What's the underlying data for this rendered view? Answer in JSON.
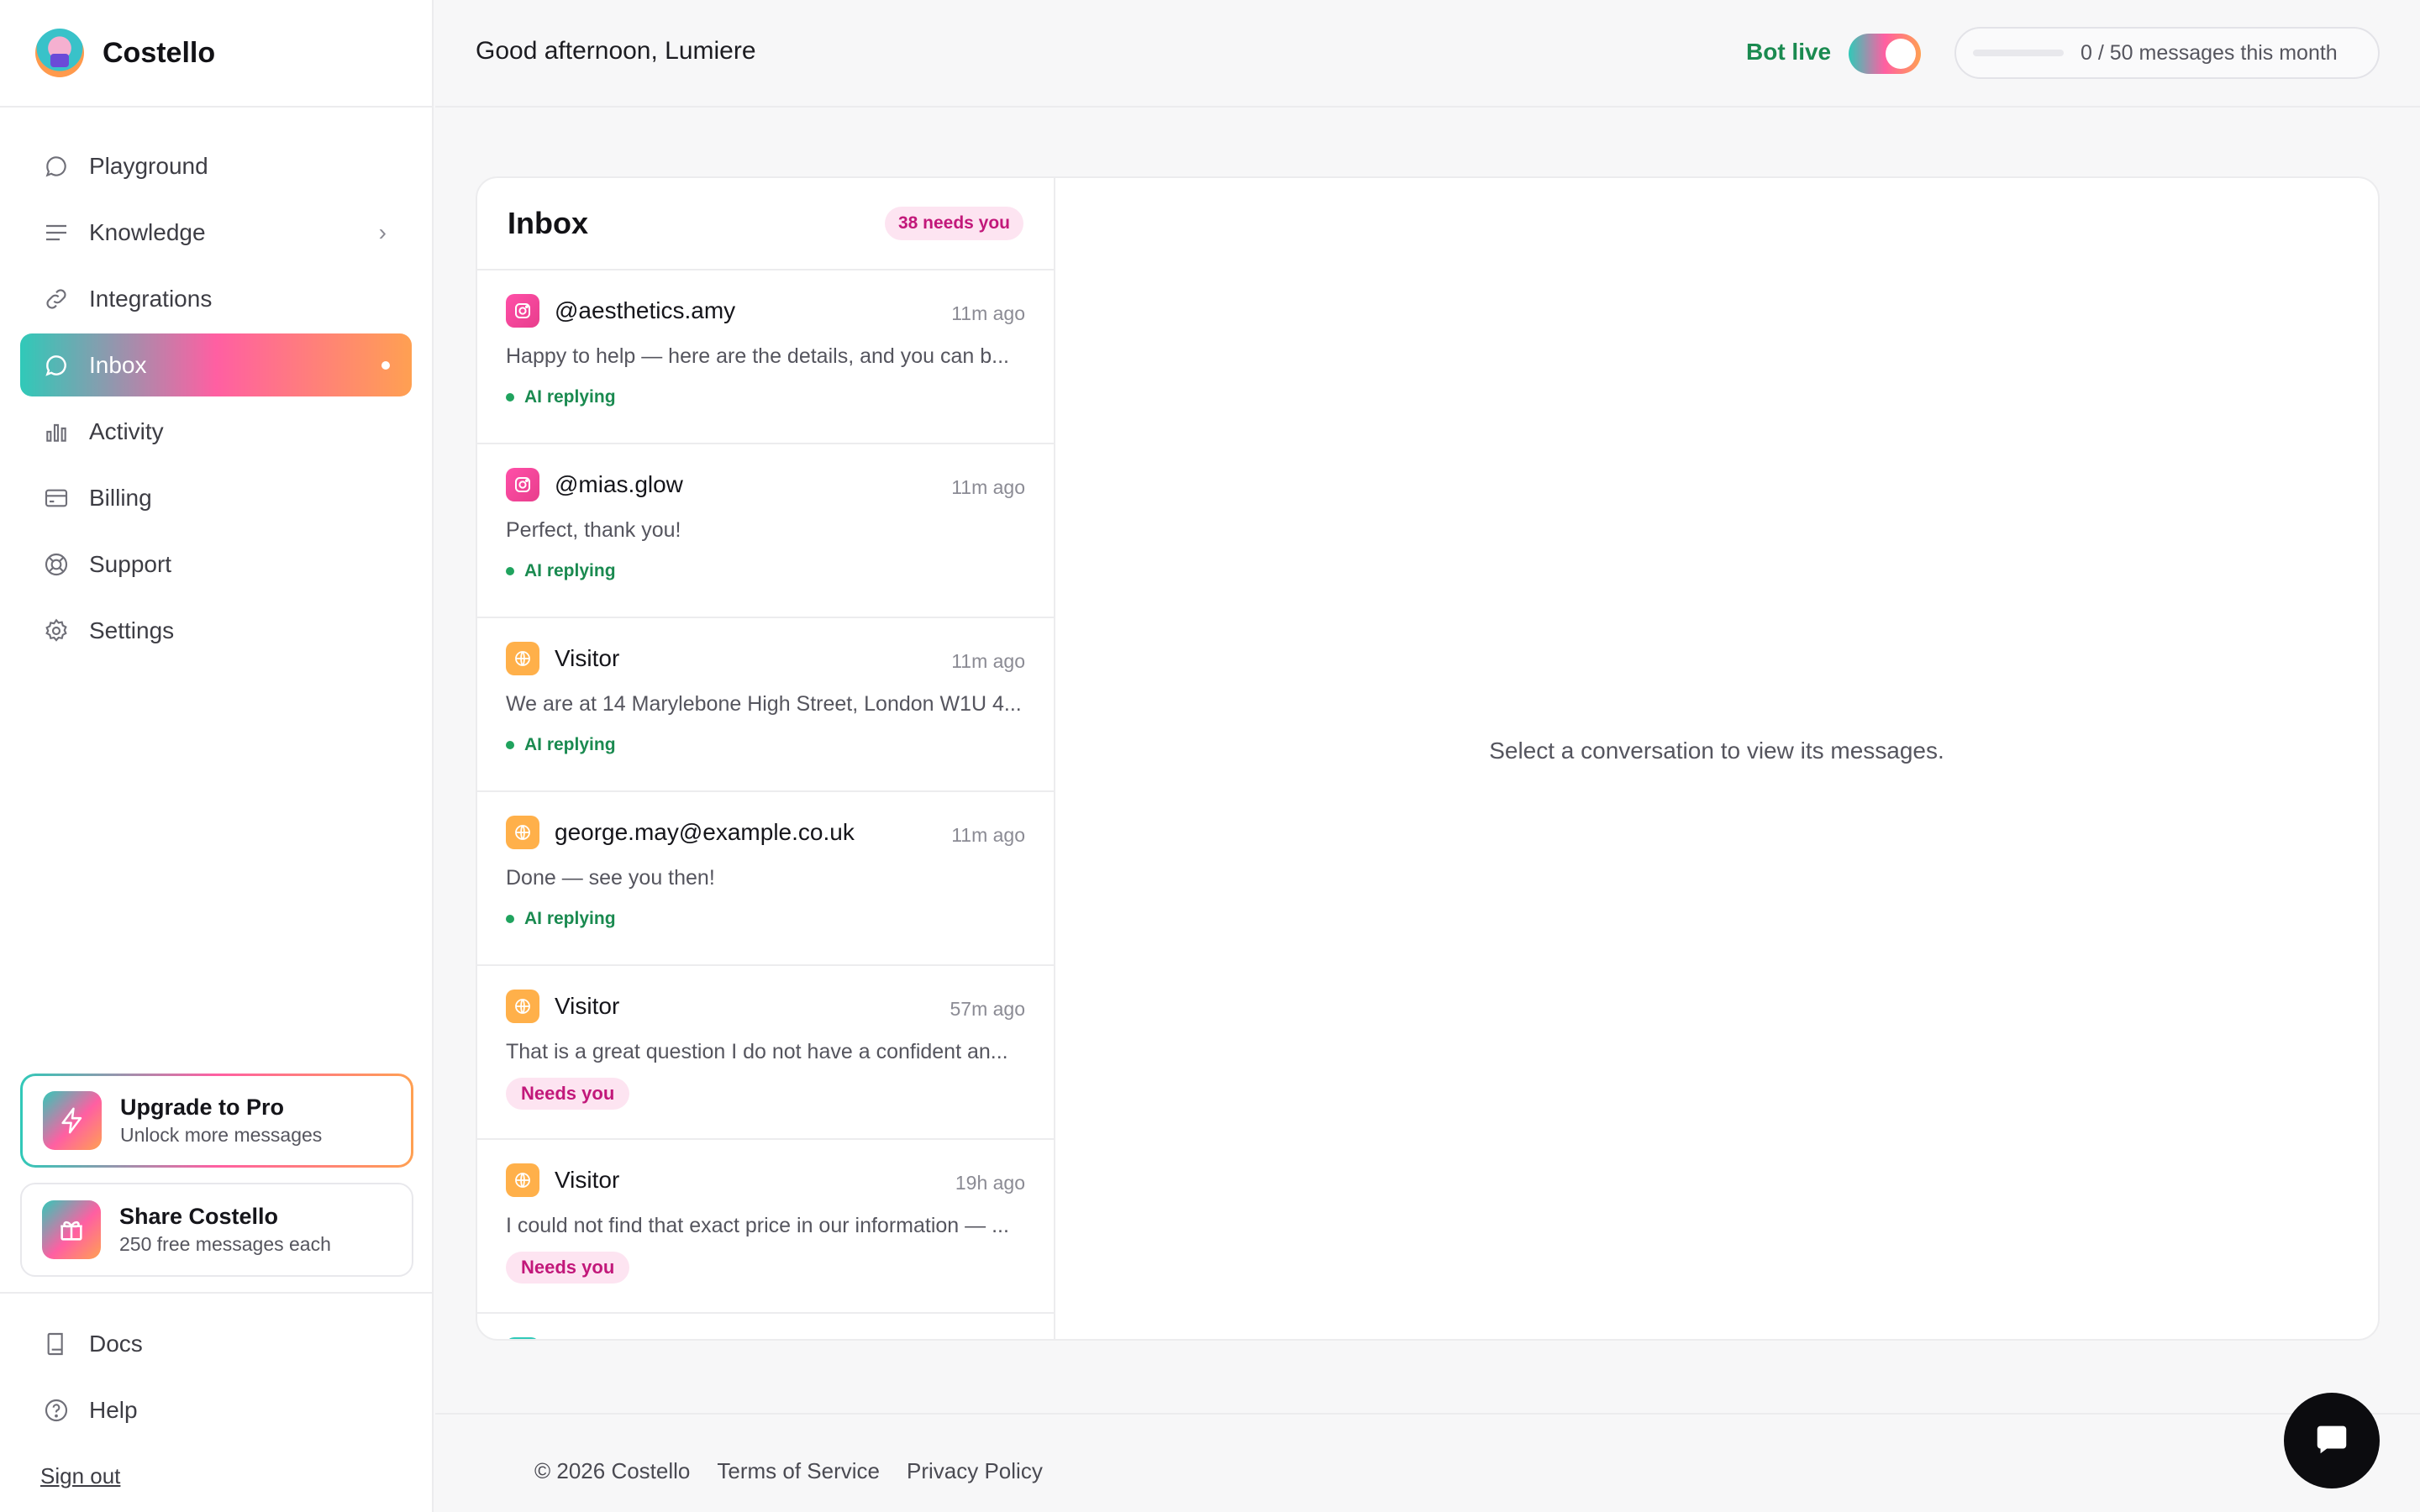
{
  "brand": {
    "name": "Costello"
  },
  "nav": {
    "items": [
      {
        "label": "Playground",
        "icon": "chat-bubble-icon"
      },
      {
        "label": "Knowledge",
        "icon": "lines-icon"
      },
      {
        "label": "Integrations",
        "icon": "link-icon"
      },
      {
        "label": "Inbox",
        "icon": "chat-bubble-icon"
      },
      {
        "label": "Activity",
        "icon": "bar-chart-icon"
      },
      {
        "label": "Billing",
        "icon": "card-icon"
      },
      {
        "label": "Support",
        "icon": "lifebuoy-icon"
      },
      {
        "label": "Settings",
        "icon": "gear-icon"
      }
    ],
    "active": "Inbox"
  },
  "promos": {
    "upgrade": {
      "title": "Upgrade to Pro",
      "subtitle": "Unlock more messages",
      "icon": "lightning-icon"
    },
    "share": {
      "title": "Share Costello",
      "subtitle": "250 free messages each",
      "icon": "gift-icon"
    }
  },
  "bottom_nav": {
    "docs": "Docs",
    "help": "Help",
    "signout": "Sign out"
  },
  "header": {
    "greeting": "Good afternoon, Lumiere",
    "bot_live": "Bot live",
    "bot_live_on": true,
    "usage_text": "0 / 50 messages this month",
    "usage_fraction": 0
  },
  "inbox": {
    "title": "Inbox",
    "needs_badge": "38 needs you",
    "conversations": [
      {
        "name": "@aesthetics.amy",
        "channel": "instagram",
        "time": "11m ago",
        "preview": "Happy to help — here are the details, and you can b...",
        "status": "AI replying",
        "status_type": "ai"
      },
      {
        "name": "@mias.glow",
        "channel": "instagram",
        "time": "11m ago",
        "preview": "Perfect, thank you!",
        "status": "AI replying",
        "status_type": "ai"
      },
      {
        "name": "Visitor",
        "channel": "web",
        "time": "11m ago",
        "preview": "We are at 14 Marylebone High Street, London W1U 4...",
        "status": "AI replying",
        "status_type": "ai"
      },
      {
        "name": "george.may@example.co.uk",
        "channel": "web",
        "time": "11m ago",
        "preview": "Done — see you then!",
        "status": "AI replying",
        "status_type": "ai"
      },
      {
        "name": "Visitor",
        "channel": "web",
        "time": "57m ago",
        "preview": "That is a great question I do not have a confident an...",
        "status": "Needs you",
        "status_type": "needs"
      },
      {
        "name": "Visitor",
        "channel": "web",
        "time": "19h ago",
        "preview": "I could not find that exact price in our information — ...",
        "status": "Needs you",
        "status_type": "needs"
      }
    ]
  },
  "empty_state": "Select a conversation to view its messages.",
  "footer": {
    "copyright": "© 2026 Costello",
    "terms": "Terms of Service",
    "privacy": "Privacy Policy"
  },
  "colors": {
    "accent_teal": "#30c9b8",
    "accent_pink": "#ff5fa2",
    "accent_orange": "#ffa052",
    "live_green": "#1a8a50"
  }
}
